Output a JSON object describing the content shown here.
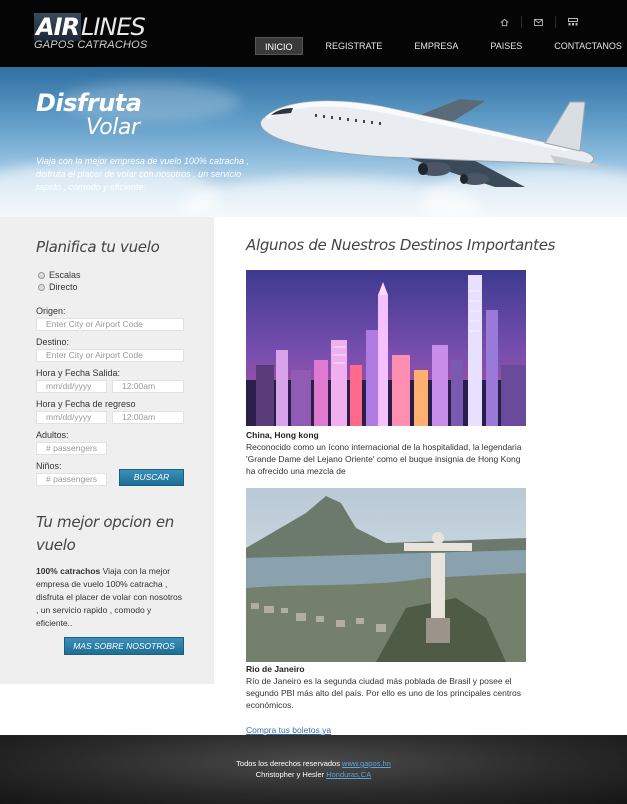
{
  "header": {
    "logo_air": "AIR",
    "logo_lines": "LINES",
    "logo_sub": "GAPOS CATRACHOS",
    "icons": [
      "home-icon",
      "mail-icon",
      "sitemap-icon"
    ],
    "nav": [
      "INICIO",
      "REGISTRATE",
      "EMPRESA",
      "PAISES",
      "CONTACTANOS"
    ],
    "active_nav": "INICIO"
  },
  "hero": {
    "title1": "Disfruta",
    "title2": "Volar",
    "text": "Viaja con la mejor empresa de vuelo 100% catracha , disfruta el placer de volar con nosotros , un servicio rapido , comodo y eficiente."
  },
  "booking": {
    "title": "Planifica tu vuelo",
    "radio1": "Escalas",
    "radio2": "Directo",
    "origin_label": "Origen:",
    "origin_placeholder": "Enter City or Airport Code",
    "dest_label": "Destino:",
    "dest_placeholder": "Enter City or Airport Code",
    "departure_label": "Hora y Fecha Salida:",
    "return_label": "Hora y Fecha de regreso",
    "date_placeholder": "mm/dd/yyyy",
    "time_placeholder": "12:00am",
    "adults_label": "Adultos:",
    "kids_label": "Niños:",
    "passengers_placeholder": "# passengers",
    "search_button": "BUSCAR"
  },
  "about": {
    "title_line1": "Tu mejor opcion en",
    "title_line2": "vuelo",
    "strong": "100% catrachos",
    "text": " Viaja con la mejor empresa de vuelo 100% catracha , disfruta el placer de volar con nosotros , un servicio rapido , comodo y eficiente..",
    "button": "MAS SOBRE NOSOTROS"
  },
  "main": {
    "title": "Algunos de Nuestros Destinos Importantes",
    "destinations": [
      {
        "name": "China, Hong kong",
        "desc": "Reconocido como un ícono internacional de la hospitalidad, la legendaria 'Grande Dame del Lejano Oriente' como el buque insignia de Hong Kong ha ofrecido una mezcla de"
      },
      {
        "name": "Rio de Janeiro",
        "desc": "Río de Janeiro es la segunda ciudad más poblada de Brasil y posee el segundo PBI más alto del país. Por ello es uno de los principales centros económicos."
      }
    ],
    "link": "Compra tus boletos ya"
  },
  "footer": {
    "line1_text": "Todos los derechos reservados ",
    "line1_link": "www.gapos.hn",
    "line2_text": "Christopher y Hesler ",
    "line2_link": "Honduras,CA"
  },
  "colors": {
    "header_bg": "#050505",
    "accent_blue": "#1f6e96",
    "panel_bg": "#efefef",
    "link": "#3a6ea5"
  }
}
